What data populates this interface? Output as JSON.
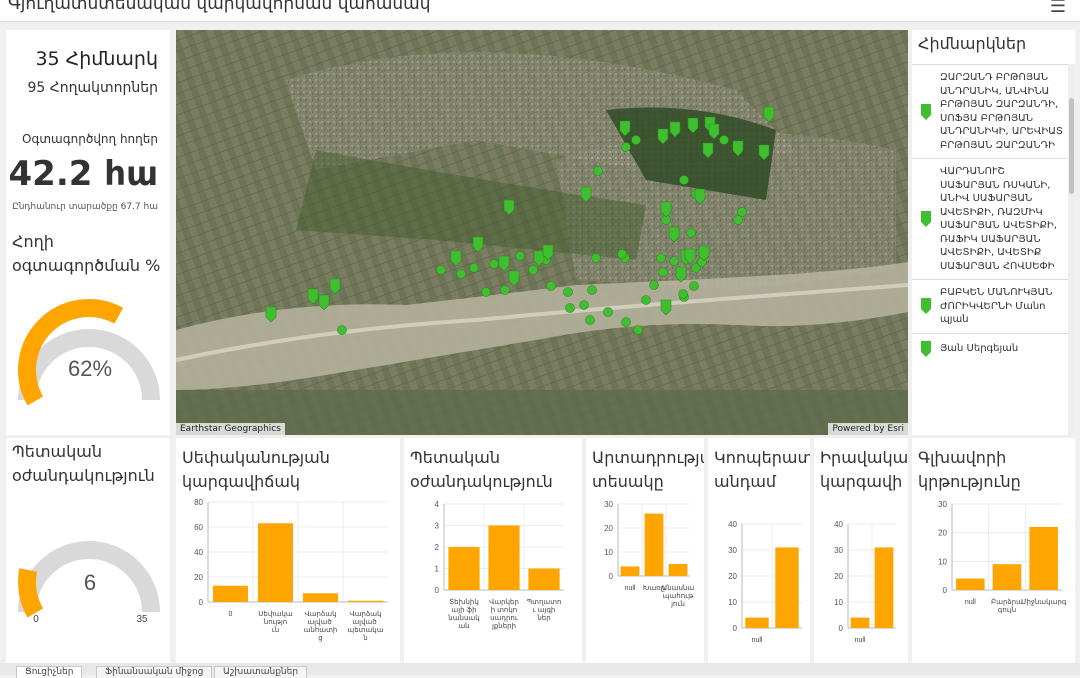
{
  "header": {
    "title": "Գյուղատնտեսական վարկավորման վահանակ",
    "menu_icon": "hamburger-icon"
  },
  "summary": {
    "beneficiaries_count": "35 Հիմնարկ",
    "plots_count": "95 Հողակտորներ",
    "used_land_label": "Օգտագործվող հողեր",
    "used_land_value": "42.2 հա",
    "total_area": "Ընդհանուր տարածքը 67.7 հա"
  },
  "gauge_land": {
    "title": "Հողի օգտագործման %",
    "value": "62%",
    "fraction": 0.62,
    "color": "#ffa500"
  },
  "gauge_support": {
    "title": "Պետական օժանդակություն",
    "value": "6",
    "min": "0",
    "max": "35",
    "fraction": 0.1714,
    "color": "#ffa500"
  },
  "map": {
    "attribution_left": "Earthstar Geographics",
    "attribution_right": "Powered by Esri",
    "marker_color": "#3fbf2f"
  },
  "list": {
    "title": "Հիմնարկներ",
    "items": [
      {
        "text": "ԶԱՐԶԱՆԴ ԲՐԹՈՅԱՆ ԱՆԴՐԱՆԻԿ, ԱՆՎԻՆԱ ԲՐԹՈՅԱՆ ԶԱՐԶԱՆԴԻ, ՍՈՖՅԱ ԲՐԹՈՅԱՆ ԱՆԴՐԱՆԻԿԻ, ԱՐԵՎԻԱՏ ԲՐԹՈՅԱՆ ԶԱՐԶԱՆԴԻ"
      },
      {
        "text": "ՎԱՐԴԱՆՈՒՇ ՍԱՖԱՐՅԱՆ ՌՍԿԱՆԻ, ԱՆԻՎ ՍԱՖԱՐՅԱՆ ԱՎԵՏԻՔԻ, ՌԱԶՄԻԿ ՍԱՖԱՐՅԱՆ ԱՎԵՏԻՔԻ, ՌԱՖԻԿ ՍԱՖԱՐՅԱՆ ԱՎԵՏԻՔԻ, ԱՎԵՏԻՔ ՍԱՖԱՐՅԱՆ ՀՈՎՍԵՓԻ"
      },
      {
        "text": "ԲԱԲԿԵՆ ՄԱՆՈՒԿՅԱՆ ԺՈՐԻԿՎԵՐՆԻ Մանո պյան"
      },
      {
        "text": "Յան Սերգեյան"
      }
    ]
  },
  "charts": {
    "ownership": {
      "title": "Սեփականության կարգավիճակ"
    },
    "state_support": {
      "title": "Պետական օժանդակություն"
    },
    "production": {
      "title": "Արտադրության տեսակը"
    },
    "coop": {
      "title": "Կոոպերատիվի անդամ"
    },
    "legal": {
      "title": "Իրավական կարգավի"
    },
    "education": {
      "title": "Գլխավորի կրթությունը"
    }
  },
  "tabs": [
    {
      "label": "Ցուցիչներ"
    },
    {
      "label": "Ֆինանսական միջոց"
    },
    {
      "label": "Աշխատանքներ"
    }
  ],
  "chart_data": [
    {
      "type": "bar",
      "title": "Սեփականության կարգավիճակ",
      "categories": [
        "0",
        "Սեփականություն",
        "Վարձակալված անհատից",
        "Վարձակալված պետական"
      ],
      "values": [
        13,
        63,
        7,
        1
      ],
      "ylim": [
        0,
        80
      ],
      "yticks": [
        0,
        20,
        40,
        60,
        80
      ],
      "bar_color": "#ffa500"
    },
    {
      "type": "bar",
      "title": "Պետական օժանդակություն",
      "categories": [
        "Տեխնիկայի ֆինանսական",
        "Վարկերի տոկոսադրույքների",
        "Պտղատու այգիներ"
      ],
      "values": [
        2,
        3,
        1
      ],
      "ylim": [
        0,
        4
      ],
      "yticks": [
        0,
        1,
        2,
        3,
        4
      ],
      "bar_color": "#ffa500"
    },
    {
      "type": "bar",
      "title": "Արտադրության տեսակը",
      "categories": [
        "null",
        "Խառը",
        "Անասնապահություն"
      ],
      "values": [
        4,
        26,
        5
      ],
      "ylim": [
        0,
        30
      ],
      "yticks": [
        0,
        10,
        20,
        30
      ],
      "bar_color": "#ffa500"
    },
    {
      "type": "bar",
      "title": "Կոոպերատիվի անդամ",
      "categories": [
        "null",
        ""
      ],
      "values": [
        4,
        31
      ],
      "ylim": [
        0,
        40
      ],
      "yticks": [
        0,
        10,
        20,
        30,
        40
      ],
      "bar_color": "#ffa500"
    },
    {
      "type": "bar",
      "title": "Իրավական կարգավի",
      "categories": [
        "null",
        ""
      ],
      "values": [
        4,
        31
      ],
      "ylim": [
        0,
        40
      ],
      "yticks": [
        0,
        10,
        20,
        30,
        40
      ],
      "bar_color": "#ffa500"
    },
    {
      "type": "bar",
      "title": "Գլխավորի կրթությունը",
      "categories": [
        "null",
        "Բարձրագույն",
        "Միջնակարգ"
      ],
      "values": [
        4,
        9,
        22
      ],
      "ylim": [
        0,
        30
      ],
      "yticks": [
        0,
        10,
        20,
        30
      ],
      "bar_color": "#ffa500"
    }
  ]
}
